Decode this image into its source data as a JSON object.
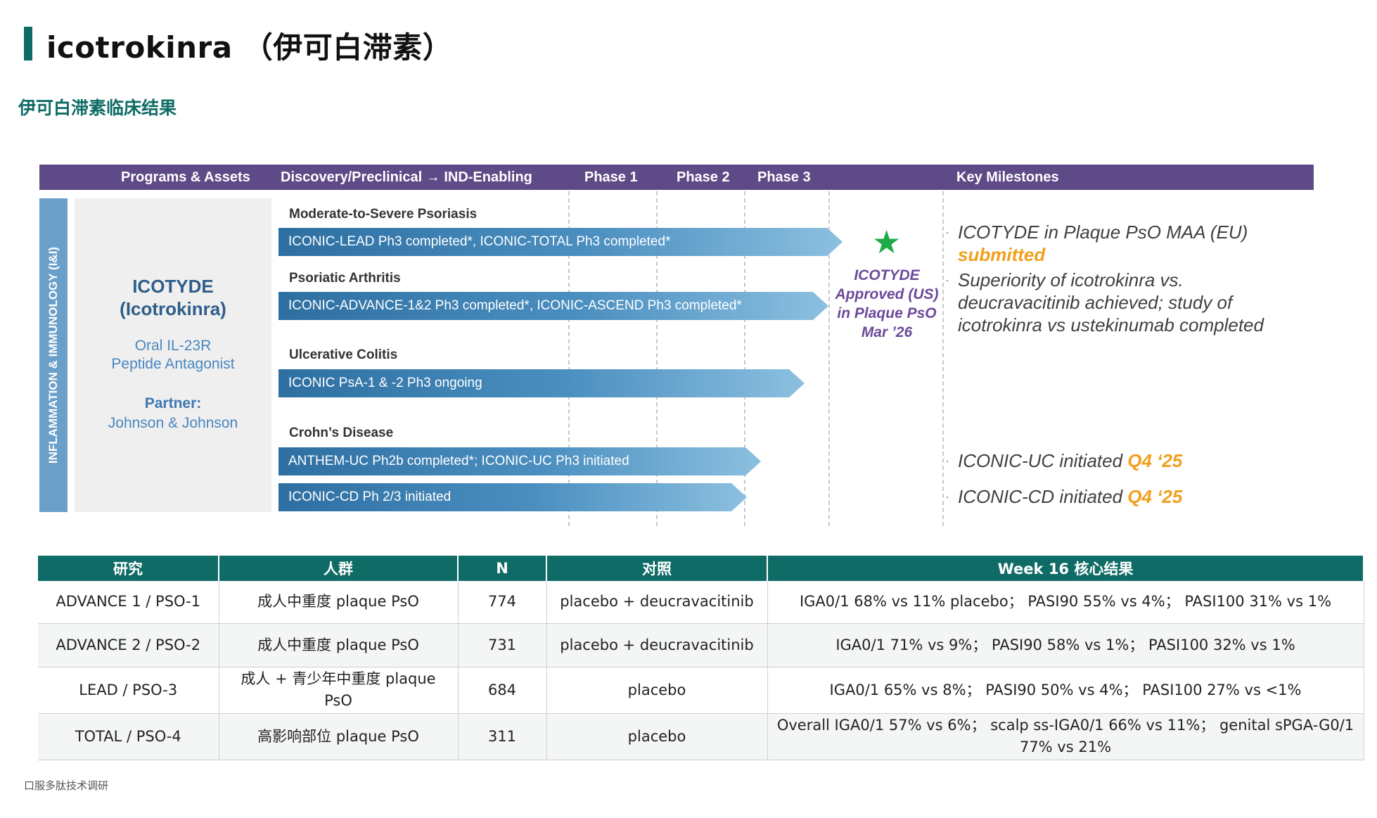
{
  "page": {
    "title": "icotrokinra （伊可白滞素）",
    "subtitle": "伊可白滞素临床结果",
    "footer": "口服多肽技术调研"
  },
  "pipeline": {
    "headers": {
      "programs": "Programs & Assets",
      "discovery": "Discovery/Preclinical → IND-Enabling",
      "phase1": "Phase 1",
      "phase2": "Phase 2",
      "phase3": "Phase 3",
      "milestones": "Key Milestones"
    },
    "side_label": "INFLAMMATION & IMMUNOLOGY (I&I)",
    "asset": {
      "name_line1": "ICOTYDE",
      "name_line2": "(Icotrokinra)",
      "desc_line1": "Oral IL-23R",
      "desc_line2": "Peptide Antagonist",
      "partner_label": "Partner:",
      "partner": "Johnson & Johnson"
    },
    "indications": [
      {
        "label": "Moderate-to-Severe Psoriasis",
        "bars": [
          "ICONIC-LEAD Ph3 completed*, ICONIC-TOTAL Ph3 completed*"
        ]
      },
      {
        "label": "Psoriatic Arthritis",
        "bars": [
          "ICONIC-ADVANCE-1&2 Ph3 completed*, ICONIC-ASCEND Ph3 completed*"
        ]
      },
      {
        "label": "Ulcerative Colitis",
        "bars": [
          "ICONIC PsA-1 & -2 Ph3 ongoing"
        ]
      },
      {
        "label": "Crohn’s Disease",
        "bars": [
          "ANTHEM-UC Ph2b completed*; ICONIC-UC Ph3 initiated",
          "ICONIC-CD Ph 2/3 initiated"
        ]
      }
    ],
    "approval": {
      "line1": "ICOTYDE",
      "line2": "Approved (US)",
      "line3": "in Plaque PsO",
      "line4": "Mar ’26"
    },
    "milestones": [
      {
        "text": "ICOTYDE in Plaque PsO MAA (EU)",
        "highlight": "submitted"
      },
      {
        "text": "Superiority of icotrokinra vs. deucravacitinib achieved; study of icotrokinra vs ustekinumab completed",
        "highlight": ""
      },
      {
        "text": "ICONIC-UC initiated",
        "highlight": "Q4 ‘25"
      },
      {
        "text": "ICONIC-CD initiated",
        "highlight": "Q4 ‘25"
      }
    ],
    "colors": {
      "header": "#5e4a86",
      "bar": "#3a7db3",
      "star": "#1faa4a",
      "approval": "#6b4a9a",
      "highlight": "#f0a01e"
    }
  },
  "table": {
    "headers": [
      "研究",
      "人群",
      "N",
      "对照",
      "Week 16 核心结果"
    ],
    "rows": [
      [
        "ADVANCE 1 / PSO-1",
        "成人中重度 plaque PsO",
        "774",
        "placebo + deucravacitinib",
        "IGA0/1 68% vs 11% placebo； PASI90 55% vs 4%； PASI100 31% vs 1%"
      ],
      [
        "ADVANCE 2 / PSO-2",
        "成人中重度 plaque PsO",
        "731",
        "placebo + deucravacitinib",
        "IGA0/1 71% vs 9%； PASI90 58% vs 1%； PASI100 32% vs 1%"
      ],
      [
        "LEAD / PSO-3",
        "成人 + 青少年中重度 plaque PsO",
        "684",
        "placebo",
        "IGA0/1 65% vs 8%； PASI90 50% vs 4%； PASI100 27% vs <1%"
      ],
      [
        "TOTAL / PSO-4",
        "高影响部位 plaque PsO",
        "311",
        "placebo",
        "Overall IGA0/1 57% vs 6%； scalp ss-IGA0/1 66% vs 11%； genital sPGA-G0/1 77% vs 21%"
      ]
    ],
    "header_color": "#0f6b66"
  }
}
